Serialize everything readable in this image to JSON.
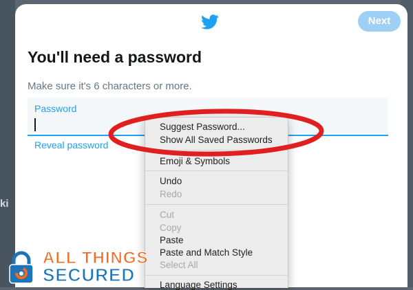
{
  "backdrop": {
    "fragment": "ki"
  },
  "header": {
    "logo_icon": "twitter-bird-icon",
    "next_label": "Next"
  },
  "form": {
    "title": "You'll need a password",
    "hint": "Make sure it's 6 characters or more.",
    "password_label": "Password",
    "reveal_label": "Reveal password"
  },
  "context_menu": {
    "items": {
      "suggest": "Suggest Password...",
      "show_saved": "Show All Saved Passwords",
      "emoji": "Emoji & Symbols",
      "undo": "Undo",
      "redo": "Redo",
      "cut": "Cut",
      "copy": "Copy",
      "paste": "Paste",
      "paste_match": "Paste and Match Style",
      "select_all": "Select All",
      "language": "Language Settings"
    }
  },
  "annotation": {
    "shape": "red-ellipse",
    "color": "#e02020"
  },
  "watermark": {
    "line1": "ALL THINGS",
    "line2": "SECURED",
    "icon": "padlock-icon"
  },
  "colors": {
    "accent": "#1da1f2",
    "next_disabled": "#9ed0f5",
    "logo_orange": "#f26b21",
    "logo_blue": "#1f74b8"
  }
}
